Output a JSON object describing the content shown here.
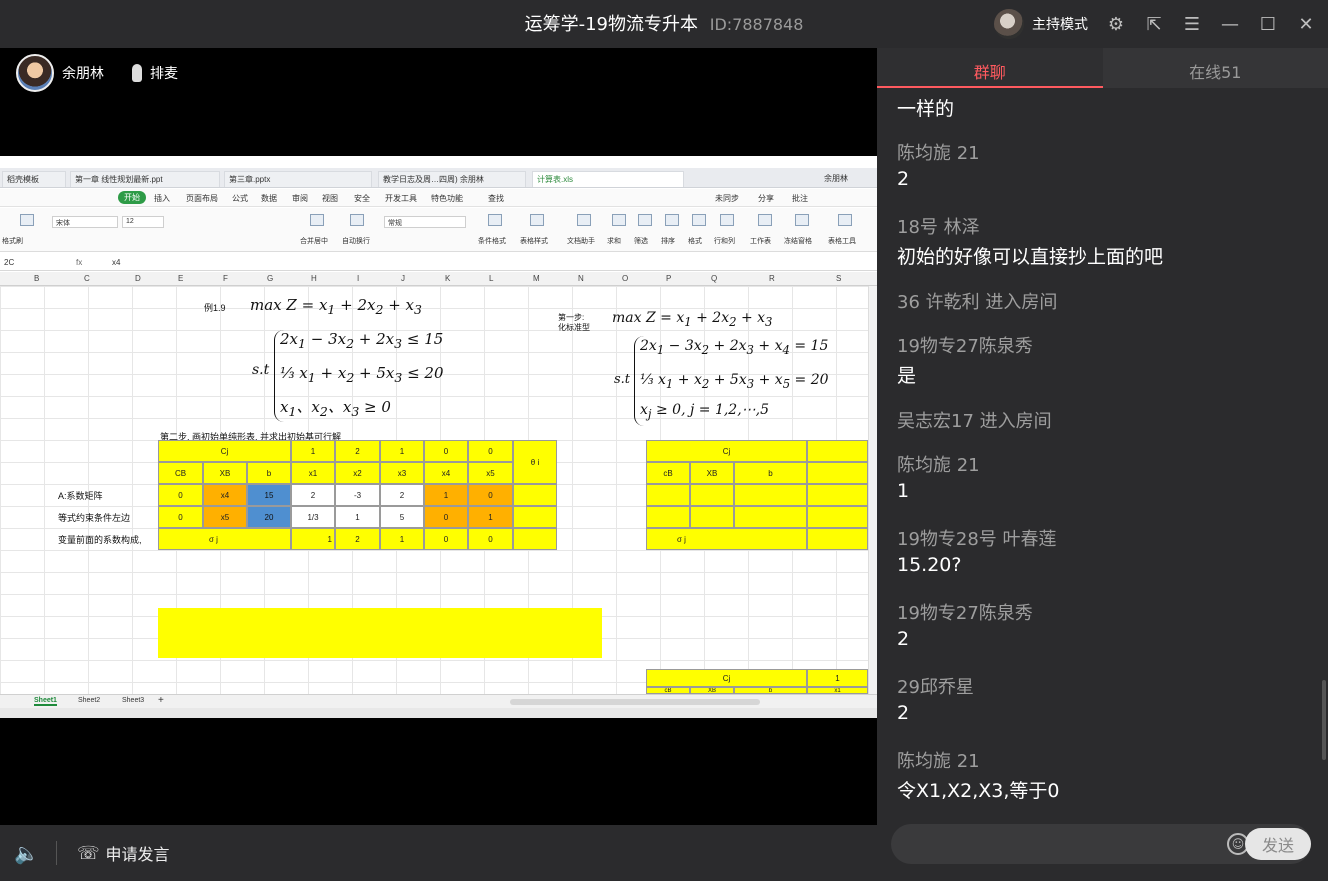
{
  "window": {
    "title": "运筹学-19物流专升本",
    "room_id": "ID:7887848",
    "host_mode": "主持模式",
    "icons": [
      "settings-icon",
      "popout-icon",
      "menu-icon",
      "minimize-icon",
      "maximize-icon",
      "close-icon"
    ]
  },
  "presenter": {
    "name": "余朋林",
    "queue_label": "排麦"
  },
  "spreadsheet": {
    "tabs": [
      "稻壳模板",
      "第一章 线性规划最新.ppt",
      "第三章.pptx",
      "教学日志及周…四周) 余朋林",
      "计算表.xls"
    ],
    "user": "余朋林",
    "menu": [
      "开始",
      "插入",
      "页面布局",
      "公式",
      "数据",
      "审阅",
      "视图",
      "安全",
      "开发工具",
      "特色功能",
      "查找",
      "未同步",
      "分享",
      "批注"
    ],
    "ribbon": {
      "font": "宋体",
      "size": "12",
      "format": "常规",
      "labels": [
        "格式刷",
        "合并居中",
        "自动换行",
        "条件格式",
        "表格样式",
        "文档助手",
        "求和",
        "筛选",
        "排序",
        "格式",
        "行和列",
        "工作表",
        "冻结窗格",
        "表格工具"
      ]
    },
    "cell_ref": "2C",
    "formula": "x4",
    "columns": [
      "B",
      "C",
      "D",
      "E",
      "F",
      "G",
      "H",
      "I",
      "J",
      "K",
      "L",
      "M",
      "N",
      "O",
      "P",
      "Q",
      "R",
      "S"
    ],
    "example_label": "例1.9",
    "step1_label_a": "第一步:",
    "step1_label_b": "化标准型",
    "step2_label": "第二步, 画初始单纯形表, 并求出初始基可行解",
    "row_labels": [
      "A:系数矩阵",
      "等式约束条件左边",
      "变量前面的系数构成,"
    ],
    "table": {
      "cj_header": "Cj",
      "cj_values": [
        "1",
        "2",
        "1",
        "0",
        "0"
      ],
      "theta": "θ i",
      "headers": [
        "CB",
        "XB",
        "b",
        "x1",
        "x2",
        "x3",
        "x4",
        "x5"
      ],
      "rows": [
        [
          "0",
          "x4",
          "15",
          "2",
          "-3",
          "2",
          "1",
          "0"
        ],
        [
          "0",
          "x5",
          "20",
          "1/3",
          "1",
          "5",
          "0",
          "1"
        ]
      ],
      "sigma_label": "σ j",
      "sigma_values": [
        "1",
        "2",
        "1",
        "0",
        "0"
      ]
    },
    "table2": {
      "cj": "Cj",
      "headers": [
        "cB",
        "XB",
        "b"
      ],
      "sigma": "σ j"
    },
    "table3": {
      "cj": "Cj",
      "one": "1",
      "headers": [
        "cB",
        "XB",
        "b",
        "x1"
      ]
    },
    "sheets": [
      "Sheet1",
      "Sheet2",
      "Sheet3"
    ]
  },
  "controls": {
    "apply_speak": "申请发言"
  },
  "chat": {
    "tabs": [
      "群聊",
      "在线51"
    ],
    "messages": [
      {
        "name": "",
        "text": "一样的"
      },
      {
        "name": "陈均旎 21",
        "text": "2"
      },
      {
        "name": "18号 林泽",
        "text": "初始的好像可以直接抄上面的吧"
      },
      {
        "name": " 36 许乾利 进入房间",
        "text": ""
      },
      {
        "name": "19物专27陈泉秀",
        "text": "是"
      },
      {
        "name": "吴志宏17 进入房间",
        "text": ""
      },
      {
        "name": "陈均旎 21",
        "text": "1"
      },
      {
        "name": " 19物专28号 叶春莲",
        "text": "15.20?"
      },
      {
        "name": "19物专27陈泉秀",
        "text": "2"
      },
      {
        "name": "29邱乔星",
        "text": "2"
      },
      {
        "name": "陈均旎 21",
        "text": "令X1,X2,X3,等于0"
      }
    ],
    "send_label": "发送"
  }
}
